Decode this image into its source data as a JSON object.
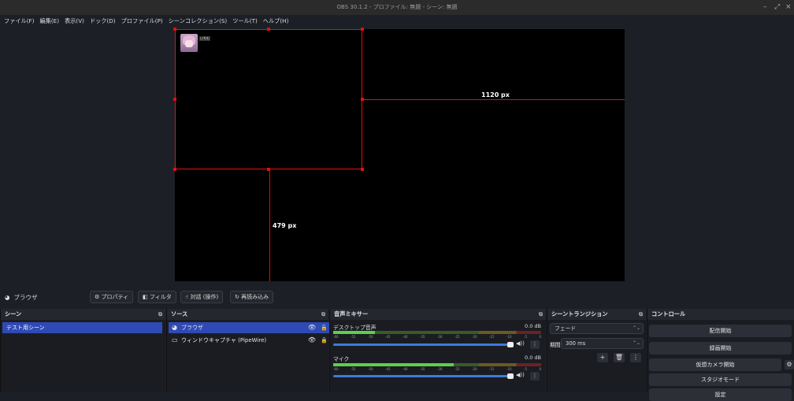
{
  "window": {
    "title": "OBS 30.1.2 - プロファイル: 無題 - シーン: 無題"
  },
  "menu": [
    "ファイル(F)",
    "編集(E)",
    "表示(V)",
    "ドック(D)",
    "プロファイル(P)",
    "シーンコレクション(S)",
    "ツール(T)",
    "ヘルプ(H)"
  ],
  "preview": {
    "width_label": "1120 px",
    "height_label": "479 px",
    "source_label": "いちむ"
  },
  "toolbar": {
    "selected_source": "ブラウザ",
    "properties": "プロパティ",
    "filters": "フィルタ",
    "interact": "対話 (操作)",
    "reload": "再読み込み"
  },
  "scenes": {
    "title": "シーン",
    "items": [
      "テスト用シーン"
    ]
  },
  "sources": {
    "title": "ソース",
    "items": [
      {
        "label": "ブラウザ",
        "icon": "globe-icon"
      },
      {
        "label": "ウィンドウキャプチャ (PipeWire)",
        "icon": "window-icon"
      }
    ]
  },
  "mixer": {
    "title": "音声ミキサー",
    "ticks": [
      "-60",
      "-55",
      "-50",
      "-45",
      "-40",
      "-35",
      "-30",
      "-25",
      "-20",
      "-15",
      "-10",
      "-5",
      "0"
    ],
    "channels": [
      {
        "name": "デスクトップ音声",
        "db": "0.0 dB",
        "level": 0.2,
        "fader": 1.0
      },
      {
        "name": "マイク",
        "db": "0.0 dB",
        "level": 0.58,
        "fader": 1.0
      }
    ]
  },
  "transitions": {
    "title": "シーントランジション",
    "type": "フェード",
    "duration_label": "期間",
    "duration_value": "300 ms"
  },
  "controls": {
    "title": "コントロール",
    "start_streaming": "配信開始",
    "start_recording": "録画開始",
    "start_virtual_camera": "仮想カメラ開始",
    "studio_mode": "スタジオモード",
    "settings": "設定"
  },
  "colors": {
    "accent": "#2f4ab5",
    "guide": "#e01010",
    "bg": "#1d1f26"
  }
}
